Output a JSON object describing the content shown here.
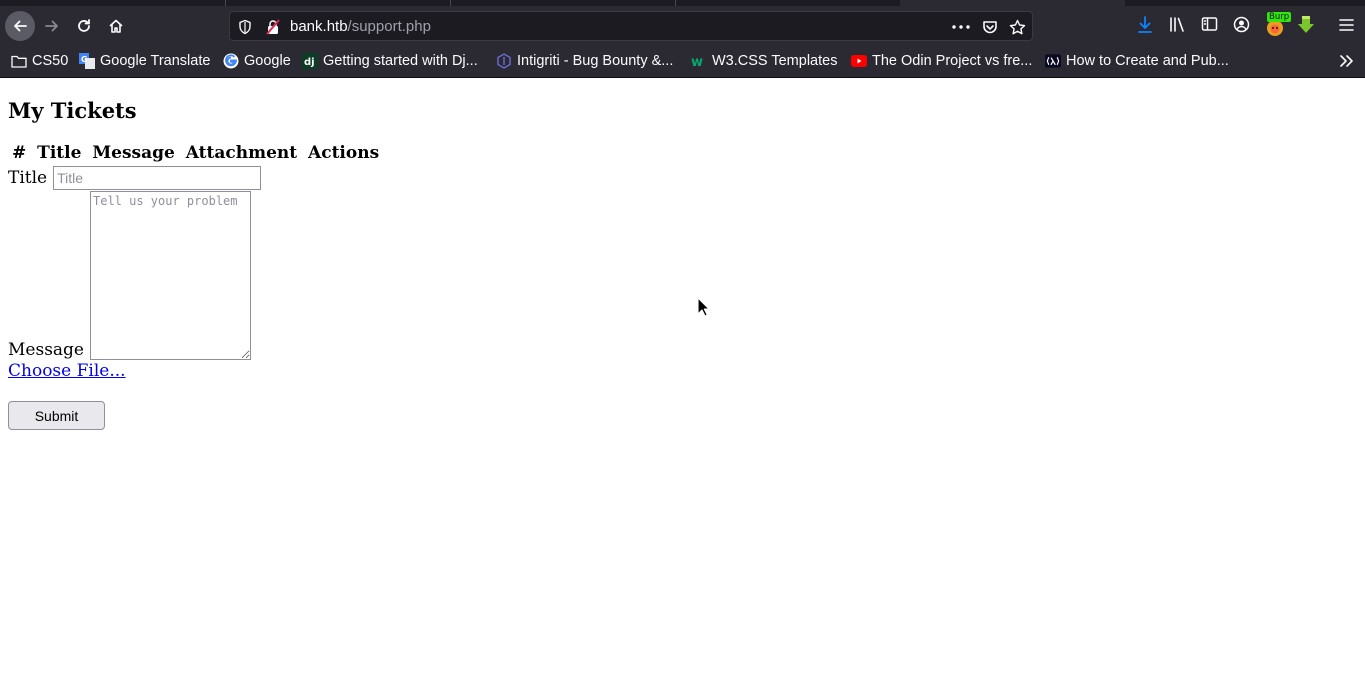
{
  "browser": {
    "url_host": "bank.htb",
    "url_path": "/support.php",
    "extension_badge": "Burp",
    "bookmarks": [
      {
        "label": "CS50",
        "icon": "folder-icon"
      },
      {
        "label": "Google Translate",
        "icon": "google-translate-icon"
      },
      {
        "label": "Google",
        "icon": "google-icon"
      },
      {
        "label": "Getting started with Dj...",
        "icon": "django-icon"
      },
      {
        "label": "Intigriti - Bug Bounty &...",
        "icon": "intigriti-icon"
      },
      {
        "label": "W3.CSS Templates",
        "icon": "w3schools-icon"
      },
      {
        "label": "The Odin Project vs fre...",
        "icon": "youtube-icon"
      },
      {
        "label": "How to Create and Pub...",
        "icon": "lambda-icon"
      }
    ]
  },
  "page": {
    "heading": "My Tickets",
    "table_headers": [
      "#",
      "Title",
      "Message",
      "Attachment",
      "Actions"
    ],
    "form": {
      "title_label": "Title",
      "title_placeholder": "Title",
      "message_label": "Message",
      "message_placeholder": "Tell us your problem",
      "file_link": "Choose File...",
      "submit_label": "Submit"
    }
  },
  "colors": {
    "chrome_bg": "#2b2a33",
    "urlbar_bg": "#1c1b22",
    "link": "#0000ee",
    "download_arrow": "#0a84ff"
  }
}
